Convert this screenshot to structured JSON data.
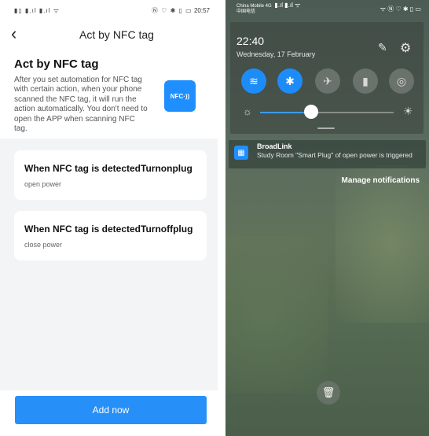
{
  "left": {
    "status_bar": {
      "left_icons": "▮▯ ▮.ıl ▮.ıl ᯤ",
      "right_icons": "Ⓝ ♡ ✱ ▯ ▭",
      "time": "20:57"
    },
    "header": {
      "back_icon": "‹",
      "title": "Act by NFC tag"
    },
    "intro": {
      "heading": "Act by NFC tag",
      "description": "After you set automation for NFC tag with certain action, when your phone scanned the NFC tag, it will run the action automatically. You don't need to open the APP when scanning NFC tag.",
      "nfc_badge": "NFC·))"
    },
    "cards": [
      {
        "title": "When NFC tag is detectedTurnonplug",
        "subtitle": "open power"
      },
      {
        "title": "When NFC tag is detectedTurnoffplug",
        "subtitle": "close power"
      }
    ],
    "add_button": "Add now"
  },
  "right": {
    "status_bar": {
      "carrier_line1": "China Mobile 4G",
      "carrier_line2": "中国电信",
      "carrier_signal": "▮.ıl ▮.ıl ᯤ",
      "right_icons": "ᯤ Ⓝ ♡ ✱ ▯ ▭"
    },
    "quick_settings": {
      "time": "22:40",
      "date": "Wednesday, 17 February",
      "edit_icon": "✎",
      "settings_icon": "⚙",
      "tiles": [
        {
          "name": "wifi",
          "glyph": "≋",
          "active": true
        },
        {
          "name": "bluetooth",
          "glyph": "✱",
          "active": true
        },
        {
          "name": "airplane",
          "glyph": "✈",
          "active": false
        },
        {
          "name": "flashlight",
          "glyph": "▮",
          "active": false
        },
        {
          "name": "hotspot",
          "glyph": "◎",
          "active": false
        }
      ],
      "brightness_low_icon": "☼",
      "brightness_high_icon": "☀",
      "brightness_level": 0.38
    },
    "notification": {
      "app_icon": "▦",
      "app_name": "BroadLink",
      "message": "Study Room \"Smart Plug\" of open  power is triggered"
    },
    "manage_label": "Manage notifications",
    "trash_icon": "🗑"
  },
  "colors": {
    "accent": "#2690f8",
    "left_background": "#f3f4f6"
  }
}
